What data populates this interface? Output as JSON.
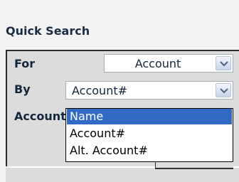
{
  "panel": {
    "title": "Quick Search"
  },
  "form": {
    "for_label": "For",
    "for_value": "Account",
    "by_label": "By",
    "by_value": "Account#",
    "account_label": "Account"
  },
  "dropdown": {
    "options": [
      "Name",
      "Account#",
      "Alt. Account#"
    ],
    "highlighted": "Name"
  },
  "colors": {
    "highlight": "#316ac5",
    "title_text": "#1b2c44",
    "panel_bg": "#dcdcdc"
  }
}
